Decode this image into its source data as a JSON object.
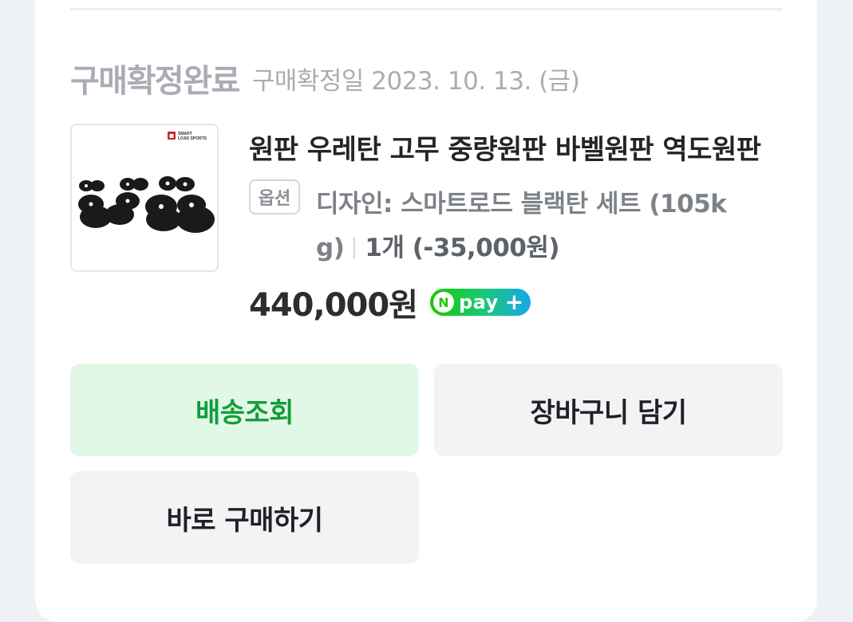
{
  "order": {
    "status_title": "구매확정완료",
    "status_date": "구매확정일 2023. 10. 13. (금)"
  },
  "product": {
    "title": "원판 우레탄 고무 중량원판 바벨원판 역도원판",
    "thumb_brand": "SMART LOAD SPORTS",
    "option_badge": "옵션",
    "option_line1": "디자인: 스마트로드 블랙탄 세트 (105k",
    "option_line2": "g)",
    "quantity": "1개 (-35,000원)",
    "price": "440,000원",
    "npay_text": "pay"
  },
  "actions": {
    "track_label": "배송조회",
    "cart_label": "장바구니 담기",
    "buy_label": "바로 구매하기"
  },
  "colors": {
    "track_bg": "#e2f8e6",
    "track_text": "#119e3b",
    "npay_green": "#1ec800"
  }
}
